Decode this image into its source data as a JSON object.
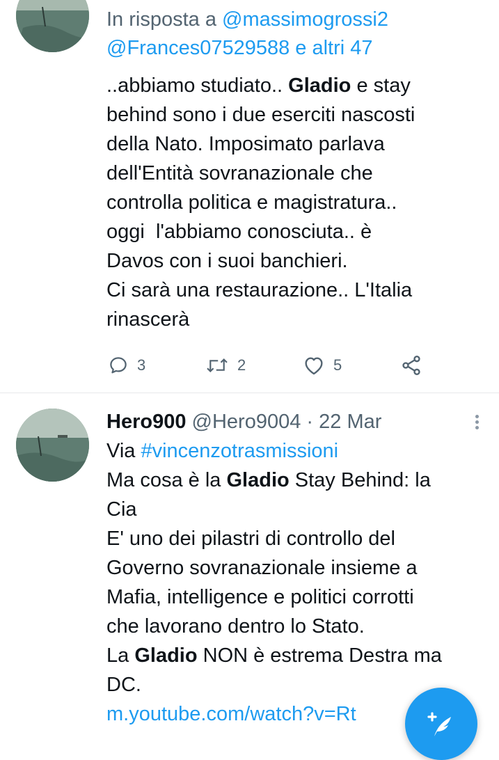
{
  "tweet1": {
    "reply_prefix": "In risposta a",
    "reply_to_user": "@massimogrossi2",
    "reply_to_others": "@Frances07529588 e altri 47",
    "lines": [
      [
        {
          "t": "..abbiamo studiato.. "
        },
        {
          "t": "Gladio",
          "b": true
        },
        {
          "t": " e stay"
        }
      ],
      [
        {
          "t": "behind sono i due eserciti nascosti"
        }
      ],
      [
        {
          "t": "della Nato. Imposimato parlava"
        }
      ],
      [
        {
          "t": "dell'Entità sovranazionale che"
        }
      ],
      [
        {
          "t": "controlla politica e magistratura.."
        }
      ],
      [
        {
          "t": "oggi  l'abbiamo conosciuta.. è"
        }
      ],
      [
        {
          "t": "Davos con i suoi banchieri."
        }
      ],
      [
        {
          "t": "Ci sarà una restaurazione.. L'Italia"
        }
      ],
      [
        {
          "t": "rinascerà"
        }
      ]
    ],
    "replies": "3",
    "retweets": "2",
    "likes": "5"
  },
  "tweet2": {
    "display_name": "Hero900",
    "handle": "@Hero9004",
    "separator": "·",
    "date": "22 Mar",
    "via_label": "Via",
    "via_tag": "#vincenzotrasmissioni",
    "lines": [
      [
        {
          "t": "Ma cosa è la "
        },
        {
          "t": "Gladio",
          "b": true
        },
        {
          "t": " Stay Behind: la"
        }
      ],
      [
        {
          "t": "Cia"
        }
      ],
      [
        {
          "t": "E' uno dei pilastri di controllo del"
        }
      ],
      [
        {
          "t": "Governo sovranazionale insieme a"
        }
      ],
      [
        {
          "t": "Mafia, intelligence e politici corrotti"
        }
      ],
      [
        {
          "t": "che lavorano dentro lo Stato."
        }
      ],
      [
        {
          "t": "La "
        },
        {
          "t": "Gladio",
          "b": true
        },
        {
          "t": " NON è estrema Destra ma"
        }
      ],
      [
        {
          "t": "DC."
        }
      ]
    ],
    "link": "m.youtube.com/watch?v=Rt"
  },
  "colors": {
    "accent": "#1d9bf0",
    "secondary_text": "#536471",
    "divider": "#e7e9ea"
  },
  "icons": {
    "reply": "speech-bubble-icon",
    "retweet": "retweet-arrows-icon",
    "like": "heart-icon",
    "share": "share-nodes-icon",
    "more": "vertical-dots-icon",
    "compose": "feather-plus-icon"
  }
}
